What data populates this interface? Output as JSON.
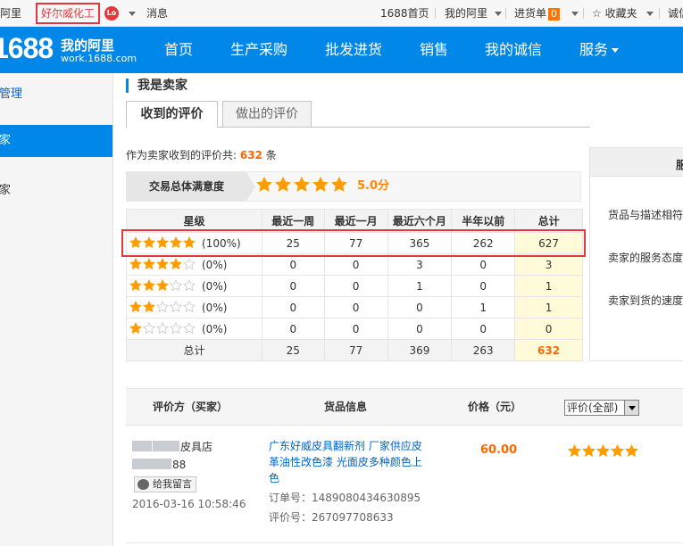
{
  "topbar": {
    "my_ali": "我的阿里",
    "shop_name": "好尔威化工",
    "level": "Lo",
    "messages": "消息",
    "home_1688": "1688首页",
    "my_ali2": "我的阿里",
    "purchase_list": "进货单",
    "purchase_count": "0",
    "favorites": "收藏夹",
    "chengxin": "诚信"
  },
  "nav": {
    "logo": "1688",
    "brand_title": "我的阿里",
    "brand_url": "work.1688.com",
    "links": [
      "首页",
      "生产采购",
      "批发进货",
      "销售",
      "我的诚信",
      "服务"
    ]
  },
  "sidebar": {
    "items": [
      "价管理",
      "卖家",
      "买家"
    ]
  },
  "main": {
    "title": "我是卖家",
    "tabs": [
      "收到的评价",
      "做出的评价"
    ],
    "summary_prefix": "作为卖家收到的评价共:",
    "summary_count": "632",
    "summary_suffix": "条",
    "satisfaction_label": "交易总体满意度",
    "satisfaction_score": "5.0分"
  },
  "rating_table": {
    "headers": [
      "星级",
      "最近一周",
      "最近一月",
      "最近六个月",
      "半年以前",
      "总计"
    ],
    "rows": [
      {
        "stars": 5,
        "pct": "(100%)",
        "week": "25",
        "month": "77",
        "six_months": "365",
        "older": "262",
        "total": "627"
      },
      {
        "stars": 4,
        "pct": "(0%)",
        "week": "0",
        "month": "0",
        "six_months": "3",
        "older": "0",
        "total": "3"
      },
      {
        "stars": 3,
        "pct": "(0%)",
        "week": "0",
        "month": "0",
        "six_months": "1",
        "older": "0",
        "total": "1"
      },
      {
        "stars": 2,
        "pct": "(0%)",
        "week": "0",
        "month": "0",
        "six_months": "0",
        "older": "1",
        "total": "1"
      },
      {
        "stars": 1,
        "pct": "(0%)",
        "week": "0",
        "month": "0",
        "six_months": "0",
        "older": "0",
        "total": "0"
      }
    ],
    "sum": {
      "label": "总计",
      "week": "25",
      "month": "77",
      "six_months": "369",
      "older": "263",
      "total": "632"
    }
  },
  "right_panel": {
    "head": "服",
    "items": [
      "货品与描述相符",
      "卖家的服务态度",
      "卖家到货的速度"
    ]
  },
  "reviews": {
    "headers": {
      "buyer": "评价方（买家）",
      "product": "货品信息",
      "price": "价格（元）"
    },
    "filter": "评价(全部)",
    "items": [
      {
        "buyer_suffix": "皮具店",
        "buyer_id_suffix": "88",
        "msg_button": "给我留言",
        "date": "2016-03-16 10:58:46",
        "product": "广东好威皮具翻新剂 厂家供应皮革油性改色漆 光面皮多种颜色上色",
        "order": "订单号：1489080434630895",
        "eval_no": "评价号：267097708633",
        "price": "60.00",
        "stars": 5
      }
    ]
  },
  "colors": {
    "brand_blue": "#0087e8",
    "highlight_red": "#e4393c",
    "orange": "#ff6600",
    "star": "#ff9c00"
  }
}
